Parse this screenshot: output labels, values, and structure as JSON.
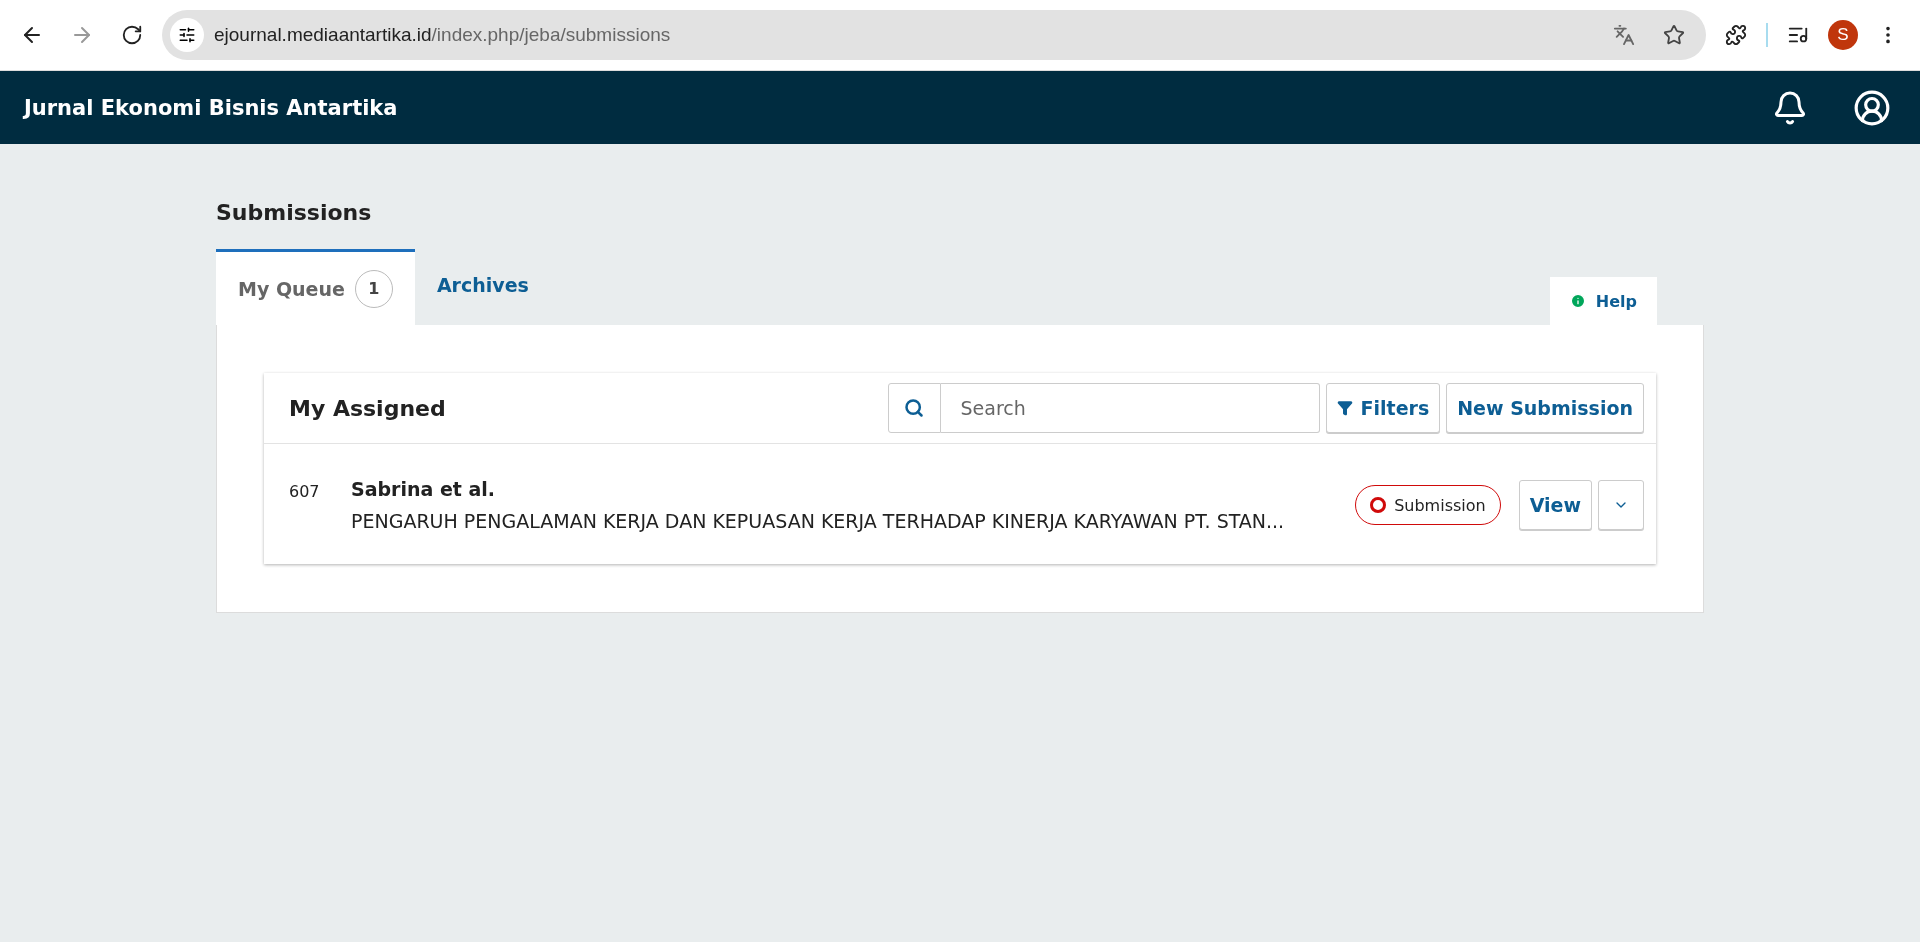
{
  "browser": {
    "url_host": "ejournal.mediaantartika.id",
    "url_path": "/index.php/jeba/submissions",
    "profile_initial": "S"
  },
  "header": {
    "title": "Jurnal Ekonomi Bisnis Antartika"
  },
  "page": {
    "title": "Submissions"
  },
  "tabs": [
    {
      "label": "My Queue",
      "count": "1",
      "selected": true
    },
    {
      "label": "Archives",
      "selected": false
    }
  ],
  "help": {
    "label": "Help"
  },
  "list": {
    "title": "My Assigned",
    "search": {
      "placeholder": "Search"
    },
    "buttons": [
      "Filters",
      "New Submission"
    ],
    "items": [
      {
        "id": "607",
        "author": "Sabrina et al.",
        "title": "PENGARUH PENGALAMAN KERJA DAN KEPUASAN KERJA TERHADAP KINERJA KARYAWAN PT. STAN...",
        "stage": "Submission",
        "color": "#d00a0a",
        "action": "View"
      }
    ]
  }
}
